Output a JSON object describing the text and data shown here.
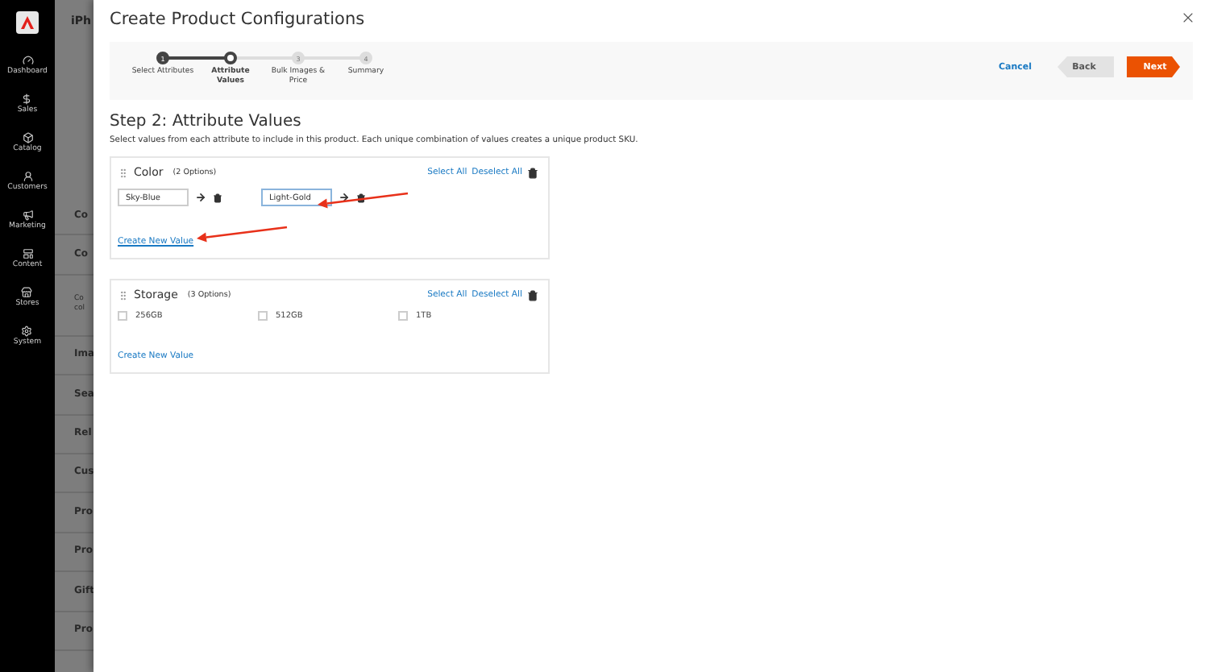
{
  "sidebar": {
    "items": [
      {
        "label": "Dashboard"
      },
      {
        "label": "Sales"
      },
      {
        "label": "Catalog"
      },
      {
        "label": "Customers"
      },
      {
        "label": "Marketing"
      },
      {
        "label": "Content"
      },
      {
        "label": "Stores"
      },
      {
        "label": "System"
      }
    ]
  },
  "background_page": {
    "title": "iPh",
    "sections": [
      {
        "label": "Co",
        "kind": "heading"
      },
      {
        "label": "Co",
        "kind": "heading"
      },
      {
        "label": "Co\ncol",
        "kind": "note"
      },
      {
        "label": "Ima",
        "kind": "heading"
      },
      {
        "label": "Sea",
        "kind": "heading"
      },
      {
        "label": "Rel",
        "kind": "heading"
      },
      {
        "label": "Cus",
        "kind": "heading"
      },
      {
        "label": "Pro",
        "kind": "heading"
      },
      {
        "label": "Pro",
        "kind": "heading"
      },
      {
        "label": "Gift",
        "kind": "heading"
      },
      {
        "label": "Pro",
        "kind": "heading"
      }
    ]
  },
  "modal": {
    "title": "Create Product Configurations",
    "steps": [
      {
        "number": "1",
        "label": "Select Attributes",
        "completed": true,
        "selected": false
      },
      {
        "label": "Attribute Values",
        "completed": false,
        "selected": true
      },
      {
        "number": "3",
        "label": "Bulk Images & Price",
        "completed": false,
        "selected": false
      },
      {
        "number": "4",
        "label": "Summary",
        "completed": false,
        "selected": false
      }
    ],
    "actions": {
      "cancel": "Cancel",
      "back": "Back",
      "next": "Next"
    },
    "heading": "Step 2: Attribute Values",
    "description": "Select values from each attribute to include in this product. Each unique combination of values creates a unique product SKU.",
    "attributes": [
      {
        "name": "Color",
        "count": "(2 Options)",
        "kind": "text",
        "select_all": "Select All",
        "deselect_all": "Deselect All",
        "values": [
          {
            "label": "Sky-Blue",
            "focused": false
          },
          {
            "label": "Light-Gold",
            "focused": true
          }
        ],
        "create_link": "Create New Value",
        "create_underlined": true
      },
      {
        "name": "Storage",
        "count": "(3 Options)",
        "kind": "checkbox",
        "select_all": "Select All",
        "deselect_all": "Deselect All",
        "values": [
          {
            "label": "256GB",
            "checked": false
          },
          {
            "label": "512GB",
            "checked": false
          },
          {
            "label": "1TB",
            "checked": false
          }
        ],
        "create_link": "Create New Value",
        "create_underlined": false
      }
    ]
  },
  "annotations": [
    {
      "kind": "arrow"
    },
    {
      "kind": "arrow"
    }
  ]
}
